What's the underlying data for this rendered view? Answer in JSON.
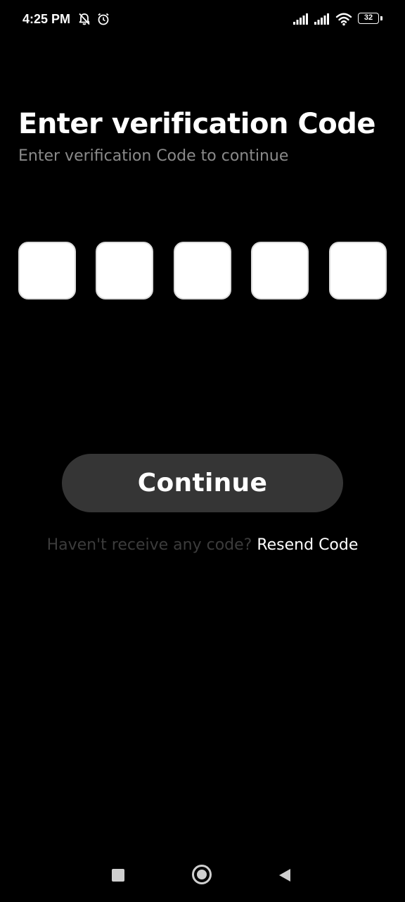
{
  "status_bar": {
    "time": "4:25 PM",
    "icons": [
      "bell-off-icon",
      "alarm-icon",
      "signal-icon",
      "signal-icon",
      "wifi-icon",
      "battery-icon"
    ],
    "battery_level": "32"
  },
  "header": {
    "title": "Enter verification Code",
    "subtitle": "Enter verification Code to continue"
  },
  "code_inputs": [
    "",
    "",
    "",
    "",
    ""
  ],
  "actions": {
    "continue_label": "Continue",
    "resend_prompt": "Haven't receive any code?",
    "resend_link": "Resend Code"
  },
  "nav_bar": {
    "icons": [
      "recents-square-icon",
      "home-circle-icon",
      "back-triangle-icon"
    ]
  },
  "colors": {
    "background": "#000000",
    "box_fill": "#ffffff",
    "button_fill": "#353535",
    "subtitle_text": "#8a8a8a",
    "prompt_text": "#3c3c3c"
  }
}
